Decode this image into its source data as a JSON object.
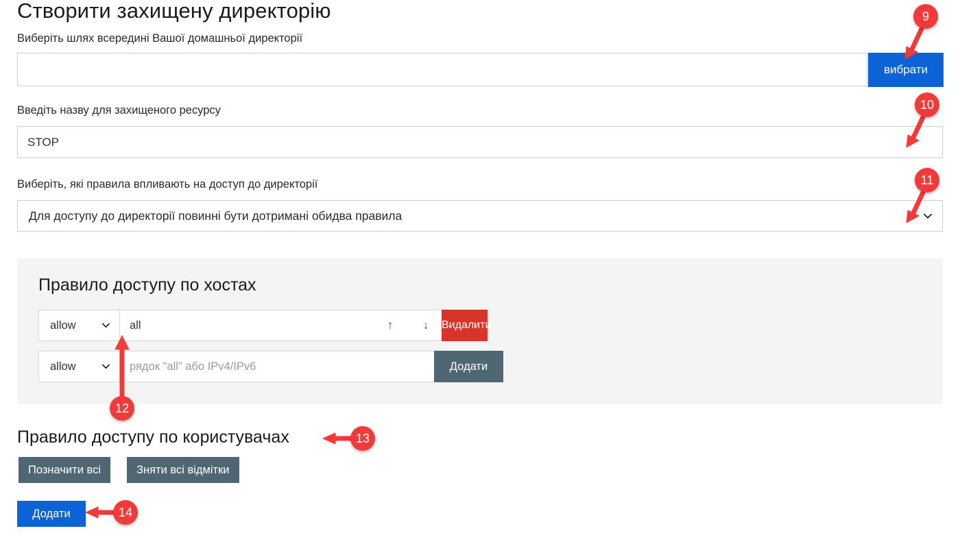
{
  "page": {
    "title": "Створити захищену директорію"
  },
  "form": {
    "path_label": "Виберіть шлях всередині Вашої домашньої директорії",
    "path_value": "",
    "path_placeholder": "",
    "choose_button": "вибрати",
    "name_label": "Введіть назву для захищеного ресурсу",
    "name_value": "STOP",
    "name_placeholder": "",
    "rules_label": "Виберіть, які правила впливають на доступ до директорії",
    "rules_selected": "Для доступу до директорії повинні бути дотримані обидва правила"
  },
  "host_rules": {
    "heading": "Правило доступу по хостах",
    "existing": {
      "action": "allow",
      "value": "all",
      "move_up_icon": "↑",
      "move_down_icon": "↓",
      "delete_button": "Видалити"
    },
    "new": {
      "action": "allow",
      "placeholder": "рядок \"all\" або IPv4/IPv6",
      "add_button": "Додати"
    }
  },
  "user_rules": {
    "heading": "Правило доступу по користувачах",
    "check_all_button": "Позначити всі",
    "uncheck_all_button": "Зняти всі відмітки"
  },
  "submit_button": "Додати",
  "markers": [
    {
      "number": "9"
    },
    {
      "number": "10"
    },
    {
      "number": "11"
    },
    {
      "number": "12"
    },
    {
      "number": "13"
    },
    {
      "number": "14"
    }
  ],
  "colors": {
    "primary_blue": "#0c63d6",
    "danger_red": "#d9342b",
    "slate_gray": "#4f6673",
    "marker_red": "#f23a3a",
    "panel_gray": "#f4f4f4"
  }
}
